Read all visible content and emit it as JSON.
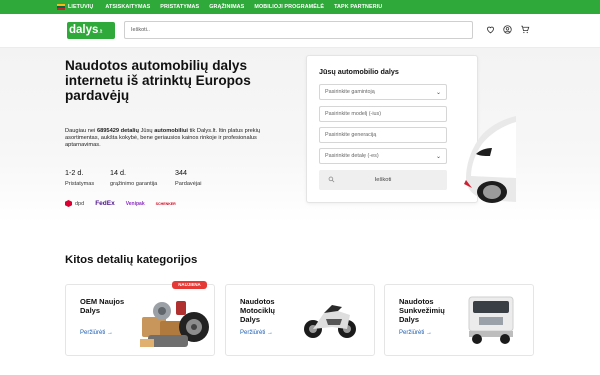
{
  "topbar": {
    "lang": "LIETUVIŲ",
    "links": [
      "ATSISKAITYMAS",
      "PRISTATYMAS",
      "GRĄŽINIMAS",
      "MOBILIOJI PROGRAMĖLĖ",
      "TAPK PARTNERIU"
    ],
    "color": "#2faa3a"
  },
  "header": {
    "logo_main": "dalys",
    "logo_tld": ".lt",
    "search_placeholder": "Ieškoti..",
    "icons": [
      "heart-icon",
      "user-icon",
      "cart-icon"
    ]
  },
  "hero": {
    "title": "Naudotos automobilių dalys internetu iš atrinktų Europos pardavėjų",
    "desc_pre": "Daugiau nei ",
    "desc_count": "6895429 detalių",
    "desc_mid": " Jūsų ",
    "desc_bold2": "automobiliui",
    "desc_post": " tik Dalys.lt. Itin platus prekių asortimentas, aukšta kokybė, bene geriausios kainos rinkoje ir profesionalus aptarnavimas.",
    "stats": [
      {
        "value": "1-2 d.",
        "label": "Pristatymas"
      },
      {
        "value": "14 d.",
        "label": "grąžinimo garantija"
      },
      {
        "value": "344",
        "label": "Pardavėjai"
      }
    ],
    "carriers": [
      "dpd",
      "FedEx",
      "Venipak",
      "SCHENKER"
    ]
  },
  "search_card": {
    "title": "Jūsų automobilio dalys",
    "fields": [
      {
        "placeholder": "Pasirinkite gamintoją",
        "dropdown": true
      },
      {
        "placeholder": "Pasirinkite modelį (-ius)",
        "dropdown": false
      },
      {
        "placeholder": "Pasirinkite generaciją",
        "dropdown": false
      },
      {
        "placeholder": "Pasirinkite detalę (-es)",
        "dropdown": true
      }
    ],
    "button": "Ieškoti"
  },
  "categories": {
    "title": "Kitos detalių kategorijos",
    "badge": "NAUJIENA",
    "items": [
      {
        "title_l1": "OEM Naujos",
        "title_l2": "Dalys",
        "title_l3": "",
        "link": "Peržiūrėti →"
      },
      {
        "title_l1": "Naudotos",
        "title_l2": "Motociklų",
        "title_l3": "Dalys",
        "link": "Peržiūrėti →"
      },
      {
        "title_l1": "Naudotos",
        "title_l2": "Sunkvežimių",
        "title_l3": "Dalys",
        "link": "Peržiūrėti →"
      }
    ]
  }
}
